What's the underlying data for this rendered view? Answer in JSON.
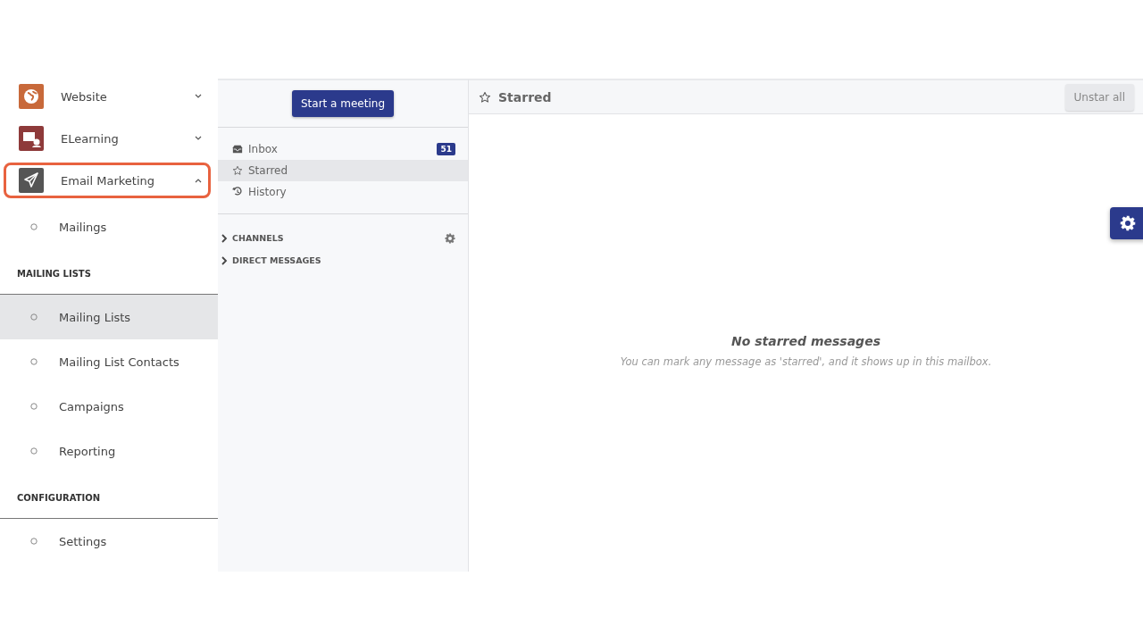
{
  "sidebar": {
    "apps": [
      {
        "label": "Website",
        "kind": "globe",
        "expanded": false,
        "highlighted": false
      },
      {
        "label": "ELearning",
        "kind": "elearning",
        "expanded": false,
        "highlighted": false
      },
      {
        "label": "Email Marketing",
        "kind": "plane",
        "expanded": true,
        "highlighted": true
      }
    ],
    "entries": [
      {
        "kind": "item",
        "label": "Mailings",
        "selected": false
      },
      {
        "kind": "section",
        "label": "MAILING LISTS"
      },
      {
        "kind": "item",
        "label": "Mailing Lists",
        "selected": true
      },
      {
        "kind": "item",
        "label": "Mailing List Contacts",
        "selected": false
      },
      {
        "kind": "item",
        "label": "Campaigns",
        "selected": false
      },
      {
        "kind": "item",
        "label": "Reporting",
        "selected": false
      },
      {
        "kind": "section",
        "label": "CONFIGURATION"
      },
      {
        "kind": "item",
        "label": "Settings",
        "selected": false
      }
    ]
  },
  "mailbox_panel": {
    "button": "Start a meeting",
    "mailboxes": [
      {
        "kind": "inbox",
        "label": "Inbox",
        "count": "51",
        "selected": false
      },
      {
        "kind": "star",
        "label": "Starred",
        "selected": true
      },
      {
        "kind": "history",
        "label": "History",
        "selected": false
      }
    ],
    "groups": [
      {
        "label": "CHANNELS",
        "settings": true
      },
      {
        "label": "DIRECT MESSAGES",
        "settings": false
      }
    ]
  },
  "content": {
    "title": "Starred",
    "action": "Unstar all",
    "empty_title": "No starred messages",
    "empty_text": "You can mark any message as 'starred', and it shows up in this mailbox."
  }
}
